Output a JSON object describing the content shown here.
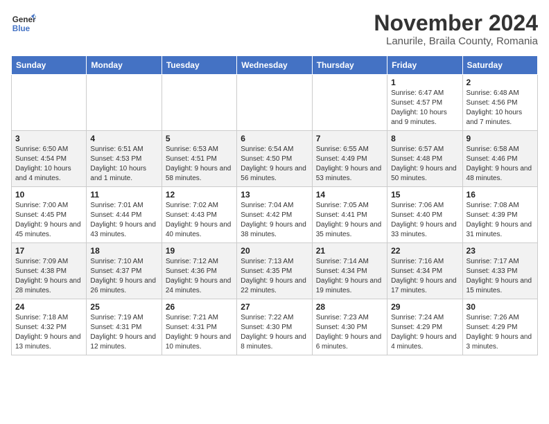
{
  "header": {
    "logo_line1": "General",
    "logo_line2": "Blue",
    "month_title": "November 2024",
    "location": "Lanurile, Braila County, Romania"
  },
  "weekdays": [
    "Sunday",
    "Monday",
    "Tuesday",
    "Wednesday",
    "Thursday",
    "Friday",
    "Saturday"
  ],
  "weeks": [
    [
      {
        "day": "",
        "info": ""
      },
      {
        "day": "",
        "info": ""
      },
      {
        "day": "",
        "info": ""
      },
      {
        "day": "",
        "info": ""
      },
      {
        "day": "",
        "info": ""
      },
      {
        "day": "1",
        "info": "Sunrise: 6:47 AM\nSunset: 4:57 PM\nDaylight: 10 hours and 9 minutes."
      },
      {
        "day": "2",
        "info": "Sunrise: 6:48 AM\nSunset: 4:56 PM\nDaylight: 10 hours and 7 minutes."
      }
    ],
    [
      {
        "day": "3",
        "info": "Sunrise: 6:50 AM\nSunset: 4:54 PM\nDaylight: 10 hours and 4 minutes."
      },
      {
        "day": "4",
        "info": "Sunrise: 6:51 AM\nSunset: 4:53 PM\nDaylight: 10 hours and 1 minute."
      },
      {
        "day": "5",
        "info": "Sunrise: 6:53 AM\nSunset: 4:51 PM\nDaylight: 9 hours and 58 minutes."
      },
      {
        "day": "6",
        "info": "Sunrise: 6:54 AM\nSunset: 4:50 PM\nDaylight: 9 hours and 56 minutes."
      },
      {
        "day": "7",
        "info": "Sunrise: 6:55 AM\nSunset: 4:49 PM\nDaylight: 9 hours and 53 minutes."
      },
      {
        "day": "8",
        "info": "Sunrise: 6:57 AM\nSunset: 4:48 PM\nDaylight: 9 hours and 50 minutes."
      },
      {
        "day": "9",
        "info": "Sunrise: 6:58 AM\nSunset: 4:46 PM\nDaylight: 9 hours and 48 minutes."
      }
    ],
    [
      {
        "day": "10",
        "info": "Sunrise: 7:00 AM\nSunset: 4:45 PM\nDaylight: 9 hours and 45 minutes."
      },
      {
        "day": "11",
        "info": "Sunrise: 7:01 AM\nSunset: 4:44 PM\nDaylight: 9 hours and 43 minutes."
      },
      {
        "day": "12",
        "info": "Sunrise: 7:02 AM\nSunset: 4:43 PM\nDaylight: 9 hours and 40 minutes."
      },
      {
        "day": "13",
        "info": "Sunrise: 7:04 AM\nSunset: 4:42 PM\nDaylight: 9 hours and 38 minutes."
      },
      {
        "day": "14",
        "info": "Sunrise: 7:05 AM\nSunset: 4:41 PM\nDaylight: 9 hours and 35 minutes."
      },
      {
        "day": "15",
        "info": "Sunrise: 7:06 AM\nSunset: 4:40 PM\nDaylight: 9 hours and 33 minutes."
      },
      {
        "day": "16",
        "info": "Sunrise: 7:08 AM\nSunset: 4:39 PM\nDaylight: 9 hours and 31 minutes."
      }
    ],
    [
      {
        "day": "17",
        "info": "Sunrise: 7:09 AM\nSunset: 4:38 PM\nDaylight: 9 hours and 28 minutes."
      },
      {
        "day": "18",
        "info": "Sunrise: 7:10 AM\nSunset: 4:37 PM\nDaylight: 9 hours and 26 minutes."
      },
      {
        "day": "19",
        "info": "Sunrise: 7:12 AM\nSunset: 4:36 PM\nDaylight: 9 hours and 24 minutes."
      },
      {
        "day": "20",
        "info": "Sunrise: 7:13 AM\nSunset: 4:35 PM\nDaylight: 9 hours and 22 minutes."
      },
      {
        "day": "21",
        "info": "Sunrise: 7:14 AM\nSunset: 4:34 PM\nDaylight: 9 hours and 19 minutes."
      },
      {
        "day": "22",
        "info": "Sunrise: 7:16 AM\nSunset: 4:34 PM\nDaylight: 9 hours and 17 minutes."
      },
      {
        "day": "23",
        "info": "Sunrise: 7:17 AM\nSunset: 4:33 PM\nDaylight: 9 hours and 15 minutes."
      }
    ],
    [
      {
        "day": "24",
        "info": "Sunrise: 7:18 AM\nSunset: 4:32 PM\nDaylight: 9 hours and 13 minutes."
      },
      {
        "day": "25",
        "info": "Sunrise: 7:19 AM\nSunset: 4:31 PM\nDaylight: 9 hours and 12 minutes."
      },
      {
        "day": "26",
        "info": "Sunrise: 7:21 AM\nSunset: 4:31 PM\nDaylight: 9 hours and 10 minutes."
      },
      {
        "day": "27",
        "info": "Sunrise: 7:22 AM\nSunset: 4:30 PM\nDaylight: 9 hours and 8 minutes."
      },
      {
        "day": "28",
        "info": "Sunrise: 7:23 AM\nSunset: 4:30 PM\nDaylight: 9 hours and 6 minutes."
      },
      {
        "day": "29",
        "info": "Sunrise: 7:24 AM\nSunset: 4:29 PM\nDaylight: 9 hours and 4 minutes."
      },
      {
        "day": "30",
        "info": "Sunrise: 7:26 AM\nSunset: 4:29 PM\nDaylight: 9 hours and 3 minutes."
      }
    ]
  ]
}
